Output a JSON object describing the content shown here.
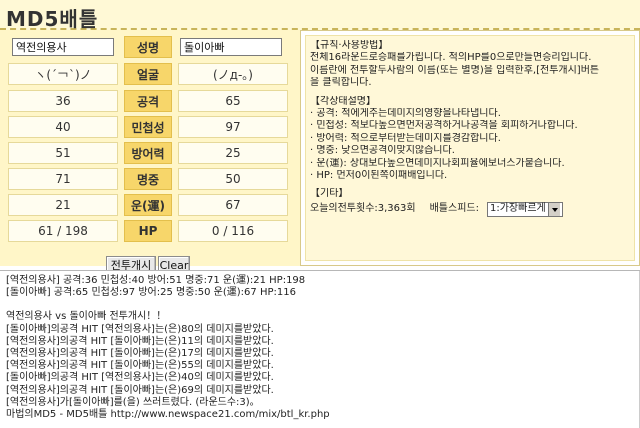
{
  "title": "MD5배틀",
  "players": {
    "left_name": "역전의용사",
    "right_name": "돌이아빠"
  },
  "stats": {
    "name_label": "성명",
    "rows": [
      {
        "label": "얼굴",
        "left": "ヽ(´￢`)ノ",
        "right": "(ノд-｡)"
      },
      {
        "label": "공격",
        "left": "36",
        "right": "65"
      },
      {
        "label": "민첩성",
        "left": "40",
        "right": "97"
      },
      {
        "label": "방어력",
        "left": "51",
        "right": "25"
      },
      {
        "label": "명중",
        "left": "71",
        "right": "50"
      },
      {
        "label": "운(運)",
        "left": "21",
        "right": "67"
      },
      {
        "label": "HP",
        "left": "61 / 198",
        "right": "0 / 116"
      }
    ]
  },
  "buttons": {
    "start": "전투개시",
    "clear": "Clear"
  },
  "rules": {
    "sec1_title": "【규칙·사용방법】",
    "sec1_lines": [
      "전체16라운드로승패를가립니다. 적의HP를0으로만들면승리입니다.",
      "이름란에 전투할두사람의 이름(또는 별명)을 입력한후,[전투개시]버튼",
      "을 클릭합니다."
    ],
    "sec2_title": "【각상태설명】",
    "sec2_lines": [
      "· 공격: 적에게주는데미지의영향을나타냅니다.",
      "· 민첩성: 적보다높으면먼저공격하거나공격을 회피하거나합니다.",
      "· 방어력: 적으로부터받는데미지를경감합니다.",
      "· 명중: 낮으면공격이맞지않습니다.",
      "· 운(運): 상대보다높으면데미지나회피율에보너스가붙습니다.",
      "· HP: 먼저0이된쪽이패배입니다."
    ],
    "sec3_title": "【기타】",
    "battle_count": "오늘의전투횟수:3,363회",
    "speed_label": "배틀스피드:",
    "speed_value": "1:가장빠르게"
  },
  "log": {
    "lines_a": [
      "[역전의용사] 공격:36 민첩성:40 방어:51 명중:71 운(運):21 HP:198",
      "[돌이아빠] 공격:65 민첩성:97 방어:25 명중:50 운(運):67 HP:116"
    ],
    "lines_b": [
      "역전의용사 vs 돌이아빠 전투개시！！",
      "[돌이아빠]의공격 HIT [역전의용사]는(은)80의 데미지를받았다.",
      "[역전의용사]의공격 HIT [돌이아빠]는(은)11의 데미지를받았다.",
      "[역전의용사]의공격 HIT [돌이아빠]는(은)17의 데미지를받았다.",
      "[역전의용사]의공격 HIT [돌이아빠]는(은)55의 데미지를받았다.",
      "[돌이아빠]의공격 HIT [역전의용사]는(은)40의 데미지를받았다.",
      "[역전의용사]의공격 HIT [돌이아빠]는(은)69의 데미지를받았다.",
      "[역전의용사]가[돌이아빠]를(을) 쓰러트렸다. (라운드수:3)。"
    ],
    "footer": "마법의MD5 - MD5배틀 http://www.newspace21.com/mix/btl_kr.php"
  }
}
